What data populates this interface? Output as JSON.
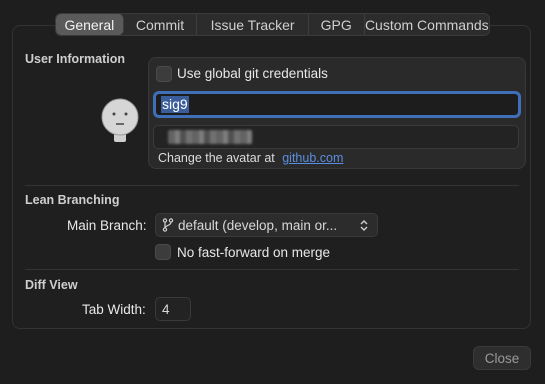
{
  "tabs": [
    {
      "label": "General",
      "active": true
    },
    {
      "label": "Commit",
      "active": false
    },
    {
      "label": "Issue Tracker",
      "active": false
    },
    {
      "label": "GPG",
      "active": false
    },
    {
      "label": "Custom Commands",
      "active": false
    }
  ],
  "user_info": {
    "title": "User Information",
    "global_credentials_label": "Use global git credentials",
    "global_credentials_checked": false,
    "name_value": "sig9",
    "avatar_note": "Change the avatar at",
    "avatar_link": "github.com"
  },
  "lean_branching": {
    "title": "Lean Branching",
    "main_branch_label": "Main Branch:",
    "main_branch_value": "default (develop, main or...",
    "no_ff_label": "No fast-forward on merge",
    "no_ff_checked": false
  },
  "diff_view": {
    "title": "Diff View",
    "tab_width_label": "Tab Width:",
    "tab_width_value": "4"
  },
  "footer": {
    "close_label": "Close"
  },
  "colors": {
    "accent": "#3e6fb8",
    "link": "#5b8ee0",
    "background": "#1e1e1e"
  }
}
